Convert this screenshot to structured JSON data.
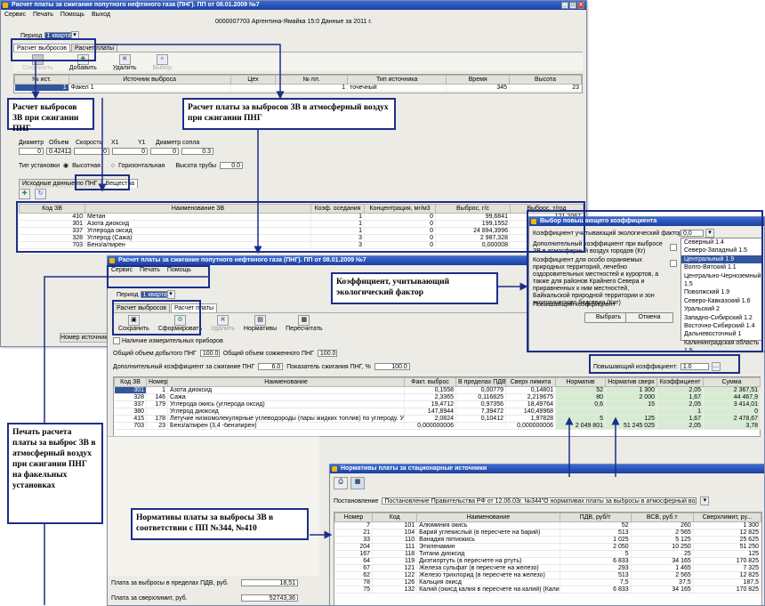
{
  "win1": {
    "title": "Расчет платы за сжигание попутного нефтяного газа (ПНГ). ПП от 08.01.2009 №7",
    "menu": [
      "Сервис",
      "Печать",
      "Помощь",
      "Выход"
    ],
    "header_line": "0000007703 Аргентина-Ямайка 15:0 Данные за 2011 г.",
    "period_label": "Период",
    "period_value": "1 квартал",
    "tabs": [
      "Расчет выбросов",
      "Расчет платы"
    ],
    "toolbar": [
      "Сохранить",
      "Добавить",
      "Удалить",
      "Выбор"
    ],
    "grid_headers": [
      "№ ист.",
      "Источник выброса",
      "Цех",
      "№ пл.",
      "Тип источника",
      "Время",
      "Высота"
    ],
    "grid_row": [
      "1",
      "Факел 1",
      "",
      "1",
      "точечный",
      "345",
      "23"
    ],
    "params_labels": [
      "Диаметр",
      "Объем",
      "Скорость",
      "X1",
      "Y1",
      "Диаметр сопла"
    ],
    "params_values": [
      "0",
      "0.42412",
      "0",
      "0",
      "0",
      "0.3"
    ],
    "install_type_label": "Тип установки",
    "install_vertical": "Высотная",
    "install_horizontal": "Горизонтальная",
    "pipe_height_label": "Высота трубы",
    "pipe_height_value": "0.0",
    "sub_tabs": [
      "Исходные данные по ПНГ",
      "Вещества"
    ],
    "subst_headers": [
      "Код ЗВ",
      "Наименование ЗВ",
      "Коэф. оседания",
      "Концентрация, мг/м3",
      "Выброс, г/с",
      "Выброс, т/год"
    ],
    "subst_rows": [
      [
        "410",
        "Метан",
        "1",
        "0",
        "99,6841",
        "121,2067"
      ],
      [
        "301",
        "Азота диоксид",
        "1",
        "0",
        "199,1552",
        ""
      ],
      [
        "337",
        "Углерода оксид",
        "1",
        "0",
        "24 894,3996",
        ""
      ],
      [
        "328",
        "Углерод (Сажа)",
        "3",
        "0",
        "2 987,328",
        ""
      ],
      [
        "703",
        "Бенз/а/пирен",
        "3",
        "0",
        "0,000008",
        ""
      ]
    ],
    "status_text": "Номер источника выб"
  },
  "win2": {
    "title": "Расчет платы за сжигание попутного нефтяного газа (ПНГ). ПП от 08.01.2009 №7",
    "menu": [
      "Сервис",
      "Печать",
      "Помощь"
    ],
    "period_label": "Период",
    "period_value": "1 квартал",
    "tabs": [
      "Расчет выбросов",
      "Расчет платы"
    ],
    "toolbar": [
      "Сохранить",
      "Сформировать",
      "Удалить",
      "Нормативы",
      "Пересчитать"
    ],
    "meters_label": "Наличие измерительных приборов",
    "volume_mined_label": "Общий объем добытого ПНГ",
    "volume_mined_value": "100.0",
    "volume_burned_label": "Общий объем сожженного ПНГ",
    "volume_burned_value": "100.0",
    "extra_coef_label": "Дополнительный коэффициент за сжигание ПНГ",
    "extra_coef_value": "6.0",
    "burn_indicator_label": "Показатель сжигания ПНГ, %",
    "burn_indicator_value": "100.0",
    "raise_coef_label": "Повышающий коэффициент:",
    "raise_coef_value": "1.0",
    "grid_headers": [
      "Код ЗВ",
      "Номер",
      "Наименование",
      "Факт. выброс",
      "В пределах ПДВ",
      "Сверх лимита",
      "Норматив",
      "Норматив сверх",
      "Коэффициент",
      "Сумма"
    ],
    "grid_rows": [
      [
        "301",
        "1",
        "Азота диоксид",
        "0,1558",
        "0,00779",
        "0,14801",
        "52",
        "1 300",
        "2,05",
        "2 367,51"
      ],
      [
        "328",
        "146",
        "Сажа",
        "2,3365",
        "0,116825",
        "2,219675",
        "80",
        "2 000",
        "1,67",
        "44 467,9"
      ],
      [
        "337",
        "179",
        "Углерода окись (углерода оксид)",
        "19,4712",
        "0,97356",
        "18,49764",
        "0,6",
        "15",
        "2,05",
        "3 414,01"
      ],
      [
        "380",
        "",
        "Углерод диоксид",
        "147,8944",
        "7,39472",
        "140,49968",
        "",
        "",
        "1",
        "0"
      ],
      [
        "415",
        "178",
        "Летучие низкомолекулярные углеводороды (пары жидких топлив) по углероду.  Угле...",
        "2,0824",
        "0,10412",
        "1,97828",
        "5",
        "125",
        "1,67",
        "2 478,67"
      ],
      [
        "703",
        "23",
        "Бенз/а/пирен (3,4 -бензпирен)",
        "0,000000006",
        "",
        "0,000000006",
        "2 049 801",
        "51 245 025",
        "2,05",
        "3,78"
      ]
    ],
    "payment_pdv_label": "Плата за выбросы в пределах ПДВ, руб.",
    "payment_pdv_value": "18,51",
    "payment_over_label": "Плата за сверхлимит, руб.",
    "payment_over_value": "52743,36"
  },
  "coef_dialog": {
    "title": "Выбор повышающего коэффициента",
    "eco_label": "Коэффициент учитывающий экологический фактор (Кэф)",
    "eco_value": "0,0",
    "protected_label": "Дополнительный коэффициент при выбросе ЗВ в атмосферный воздух городов (Кг)",
    "territory_label": "Коэффициент для особо охраняемых природных территорий, лечебно оздоровительных местностей и курортов, а также для районов Крайнего Севера и приравненных к ним местностей, Байкальской природной территории и зон экологического бедствия (Кот)",
    "raise_label": "Повышающий коэффициент",
    "select_button": "Выбрать",
    "cancel_button": "Отмена",
    "regions": [
      "Северный 1.4",
      "Северо-Западный 1.5",
      "Центральный 1.9",
      "Волго-Вятский 1.1",
      "Центрально-Черноземный 1.5",
      "Поволжский 1.9",
      "Северо-Кавказский 1.6",
      "Уральский 2",
      "Западно-Сибирский 1.2",
      "Восточно-Сибирский 1.4",
      "Дальневосточный 1",
      "Калининградская область 1.5"
    ],
    "selected_region": "Центральный 1.9"
  },
  "norms_dialog": {
    "title": "Нормативы платы за стационарные источники",
    "resolution_label": "Постановление",
    "resolution_value": "Постановление Правительства РФ от 12.06.03г. №344\"О нормативах платы за выбросы в атмосферный возд...",
    "headers": [
      "Номер",
      "Код",
      "Наименование",
      "ПДВ, руб/т",
      "ВСВ, руб.т",
      "Сверхлимит, ру..."
    ],
    "rows": [
      [
        "7",
        "101",
        "Алюминия окись",
        "52",
        "260",
        "1 300"
      ],
      [
        "21",
        "104",
        "Барий  углекислый (в пересчете на барий)",
        "513",
        "2 565",
        "12 825"
      ],
      [
        "33",
        "110",
        "Ванадия пятиокись",
        "1 025",
        "5 125",
        "25 625"
      ],
      [
        "204",
        "111",
        "Этиленамин",
        "2 050",
        "10 250",
        "51 250"
      ],
      [
        "167",
        "118",
        "Титана диоксид",
        "5",
        "25",
        "125"
      ],
      [
        "64",
        "119",
        "Диэтилртуть (в пересчете на ртуть)",
        "6 833",
        "34 165",
        "170 825"
      ],
      [
        "67",
        "121",
        "Железа сульфат (в пересчете на железо)",
        "293",
        "1 465",
        "7 325"
      ],
      [
        "62",
        "122",
        "Железо трихлорид (в пересчете на железо)",
        "513",
        "2 565",
        "12 825"
      ],
      [
        "78",
        "126",
        "Кальция окисд",
        "7,5",
        "37,5",
        "187,5"
      ],
      [
        "75",
        "132",
        "Калий  (окисд калия в пересчете на калий) (Калия",
        "6 833",
        "34 165",
        "170 825"
      ]
    ]
  },
  "notes": {
    "calc_emissions": "Расчет выбросов ЗВ при сжигании ПНГ",
    "calc_payment": "Расчет платы за выбросов ЗВ в атмосферный воздух при сжигании ПНГ",
    "eco_factor": "Коэффициент, учитывающий экологический фактор",
    "print_calc": "Печать расчета платы за выброс ЗВ в атмосферный воздух при сжигании ПНГ на факельных установках",
    "norms_note": "Нормативы платы за выбросы ЗВ в соответствии с ПП №344, №410"
  },
  "colors": {
    "title_bar": "#1d3f9e",
    "annotation_border": "#1c2e8a",
    "norm_highlight": "#d6ecd2",
    "selection": "#31559e"
  }
}
